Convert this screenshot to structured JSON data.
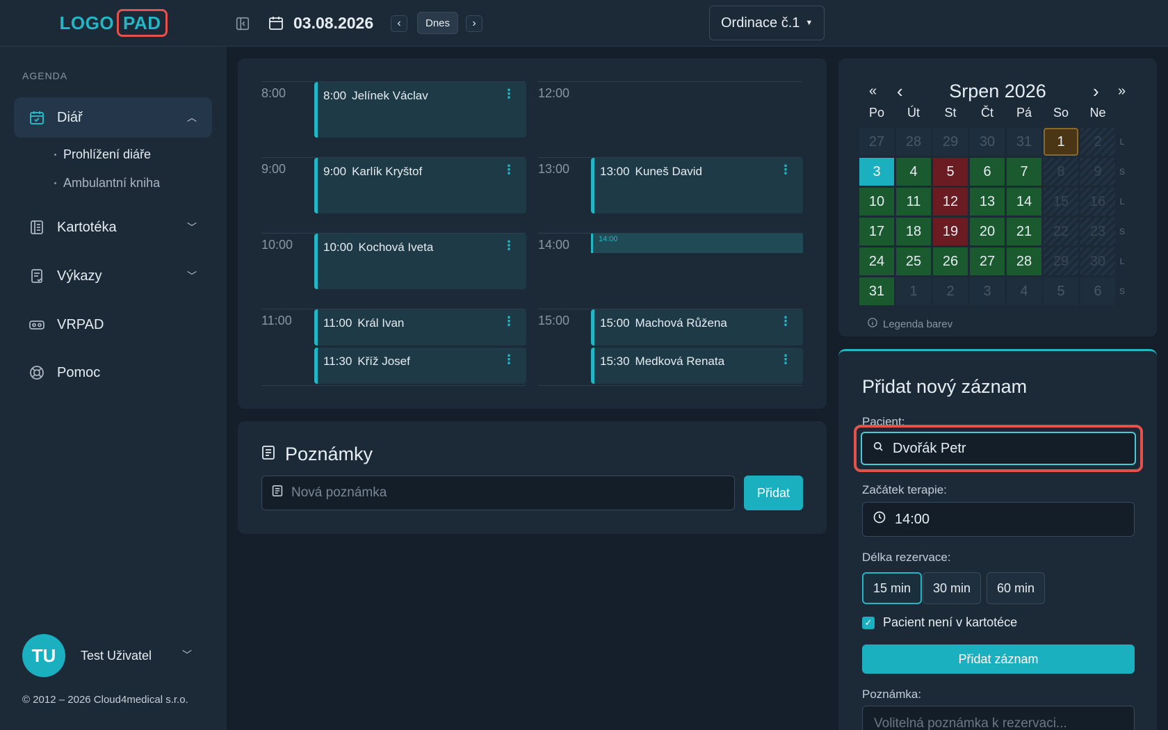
{
  "logo": {
    "text": "LOGO",
    "highlight": "PAD"
  },
  "sidebar": {
    "section": "AGENDA",
    "items": [
      {
        "label": "Diář",
        "icon": "calendar-check-icon"
      },
      {
        "label": "Kartotéka",
        "icon": "file-cabinet-icon"
      },
      {
        "label": "Výkazy",
        "icon": "report-icon"
      },
      {
        "label": "VRPAD",
        "icon": "vr-headset-icon"
      },
      {
        "label": "Pomoc",
        "icon": "lifebuoy-icon"
      }
    ],
    "sub_items": [
      "Prohlížení diáře",
      "Ambulantní kniha"
    ],
    "user": {
      "initials": "TU",
      "name": "Test Uživatel"
    },
    "copyright": "© 2012 – 2026 Cloud4medical s.r.o."
  },
  "topbar": {
    "date": "03.08.2026",
    "today_label": "Dnes",
    "ordinace": "Ordinace č.1"
  },
  "schedule": {
    "slots_left": [
      "8:00",
      "9:00",
      "10:00",
      "11:00"
    ],
    "slots_right": [
      "12:00",
      "13:00",
      "14:00",
      "15:00"
    ],
    "appointments": [
      {
        "time": "8:00",
        "name": "Jelínek Václav"
      },
      {
        "time": "9:00",
        "name": "Karlík Kryštof"
      },
      {
        "time": "10:00",
        "name": "Kochová Iveta"
      },
      {
        "time": "11:00",
        "name": "Král Ivan"
      },
      {
        "time": "11:30",
        "name": "Kříž Josef"
      },
      {
        "time": "13:00",
        "name": "Kuneš David"
      },
      {
        "time": "15:00",
        "name": "Machová Růžena"
      },
      {
        "time": "15:30",
        "name": "Medková Renata"
      }
    ],
    "new_slot_label": "14:00"
  },
  "notes": {
    "title": "Poznámky",
    "placeholder": "Nová poznámka",
    "add_label": "Přidat"
  },
  "calendar": {
    "title": "Srpen 2026",
    "nav": {
      "prev_year": "«",
      "prev": "‹",
      "next": "›",
      "next_year": "»"
    },
    "weekdays": [
      "Po",
      "Út",
      "St",
      "Čt",
      "Pá",
      "So",
      "Ne"
    ],
    "weeks": [
      [
        {
          "d": "27",
          "s": "out"
        },
        {
          "d": "28",
          "s": "out"
        },
        {
          "d": "29",
          "s": "out"
        },
        {
          "d": "30",
          "s": "out"
        },
        {
          "d": "31",
          "s": "out"
        },
        {
          "d": "1",
          "s": "hl"
        },
        {
          "d": "2",
          "s": "hatch"
        }
      ],
      [
        {
          "d": "3",
          "s": "today"
        },
        {
          "d": "4",
          "s": "green"
        },
        {
          "d": "5",
          "s": "red"
        },
        {
          "d": "6",
          "s": "green"
        },
        {
          "d": "7",
          "s": "green"
        },
        {
          "d": "8",
          "s": "hatch"
        },
        {
          "d": "9",
          "s": "hatch"
        }
      ],
      [
        {
          "d": "10",
          "s": "green"
        },
        {
          "d": "11",
          "s": "green"
        },
        {
          "d": "12",
          "s": "red"
        },
        {
          "d": "13",
          "s": "green"
        },
        {
          "d": "14",
          "s": "green"
        },
        {
          "d": "15",
          "s": "hatch"
        },
        {
          "d": "16",
          "s": "hatch"
        }
      ],
      [
        {
          "d": "17",
          "s": "green"
        },
        {
          "d": "18",
          "s": "green"
        },
        {
          "d": "19",
          "s": "red"
        },
        {
          "d": "20",
          "s": "green"
        },
        {
          "d": "21",
          "s": "green"
        },
        {
          "d": "22",
          "s": "hatch"
        },
        {
          "d": "23",
          "s": "hatch"
        }
      ],
      [
        {
          "d": "24",
          "s": "green"
        },
        {
          "d": "25",
          "s": "green"
        },
        {
          "d": "26",
          "s": "green"
        },
        {
          "d": "27",
          "s": "green"
        },
        {
          "d": "28",
          "s": "green"
        },
        {
          "d": "29",
          "s": "hatch"
        },
        {
          "d": "30",
          "s": "hatch"
        }
      ],
      [
        {
          "d": "31",
          "s": "green"
        },
        {
          "d": "1",
          "s": "plainout"
        },
        {
          "d": "2",
          "s": "plainout"
        },
        {
          "d": "3",
          "s": "plainout"
        },
        {
          "d": "4",
          "s": "plainout"
        },
        {
          "d": "5",
          "s": "plainout"
        },
        {
          "d": "6",
          "s": "plainout"
        }
      ]
    ],
    "week_parity": [
      "L",
      "S",
      "L",
      "S",
      "L",
      "S"
    ],
    "legend": "Legenda barev"
  },
  "form": {
    "title": "Přidat nový záznam",
    "patient_label": "Pacient:",
    "patient_value": "Dvořák Petr",
    "start_label": "Začátek terapie:",
    "start_value": "14:00",
    "duration_label": "Délka rezervace:",
    "durations": [
      "15 min",
      "30 min",
      "60 min"
    ],
    "selected_duration": "15 min",
    "checkbox_label": "Pacient není v kartotéce",
    "checkbox_checked": true,
    "submit_label": "Přidat záznam",
    "note_label": "Poznámka:",
    "note_placeholder": "Volitelná poznámka k rezervaci..."
  },
  "colors": {
    "accent": "#23b6c4",
    "highlight_box": "#e4524c",
    "available": "#1b5a2e",
    "unavailable": "#6a1c22"
  }
}
